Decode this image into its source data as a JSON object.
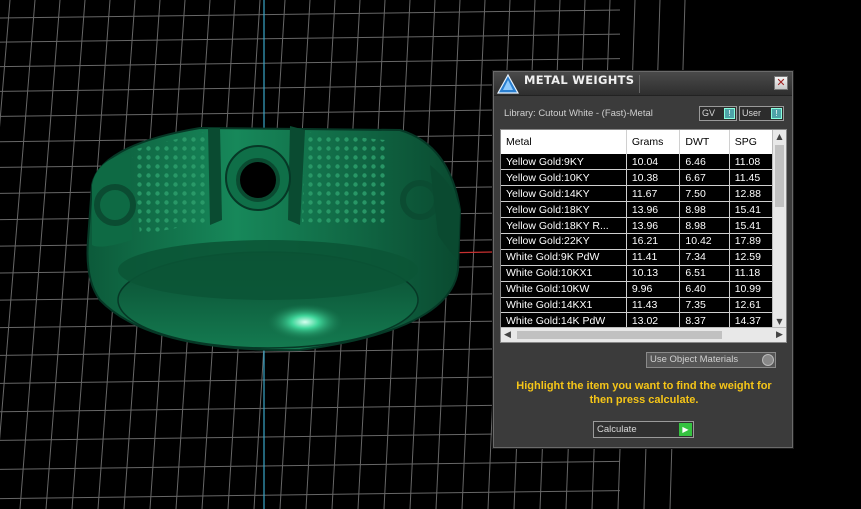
{
  "panel": {
    "title": "METAL WEIGHTS",
    "close_glyph": "✕",
    "library_label": "Library: Cutout White - (Fast)-Metal",
    "gv_select": "GV",
    "user_select": "User",
    "materials_select": "Use Object Materials",
    "hint": "Highlight the item you want to find the weight for then press calculate.",
    "calculate_label": "Calculate",
    "colors": {
      "hint": "#f5c518",
      "go": "#35c240",
      "knob": "#4ea3a8"
    }
  },
  "table": {
    "headers": [
      "Metal",
      "Grams",
      "DWT",
      "SPG"
    ],
    "rows": [
      [
        "Yellow Gold:9KY",
        "10.04",
        "6.46",
        "11.08"
      ],
      [
        "Yellow Gold:10KY",
        "10.38",
        "6.67",
        "11.45"
      ],
      [
        "Yellow Gold:14KY",
        "11.67",
        "7.50",
        "12.88"
      ],
      [
        "Yellow Gold:18KY",
        "13.96",
        "8.98",
        "15.41"
      ],
      [
        "Yellow Gold:18KY R...",
        "13.96",
        "8.98",
        "15.41"
      ],
      [
        "Yellow Gold:22KY",
        "16.21",
        "10.42",
        "17.89"
      ],
      [
        "White Gold:9K PdW",
        "11.41",
        "7.34",
        "12.59"
      ],
      [
        "White Gold:10KX1",
        "10.13",
        "6.51",
        "11.18"
      ],
      [
        "White Gold:10KW",
        "9.96",
        "6.40",
        "10.99"
      ],
      [
        "White Gold:14KX1",
        "11.43",
        "7.35",
        "12.61"
      ],
      [
        "White Gold:14K PdW",
        "13.02",
        "8.37",
        "14.37"
      ]
    ]
  },
  "viewport": {
    "colors": {
      "background": "#000000",
      "grid": "#8a8a8a",
      "ring": "#0f6b45",
      "ring_light": "#2db27a",
      "axis_y": "#3aa6c8",
      "axis_x": "#c83030"
    }
  }
}
